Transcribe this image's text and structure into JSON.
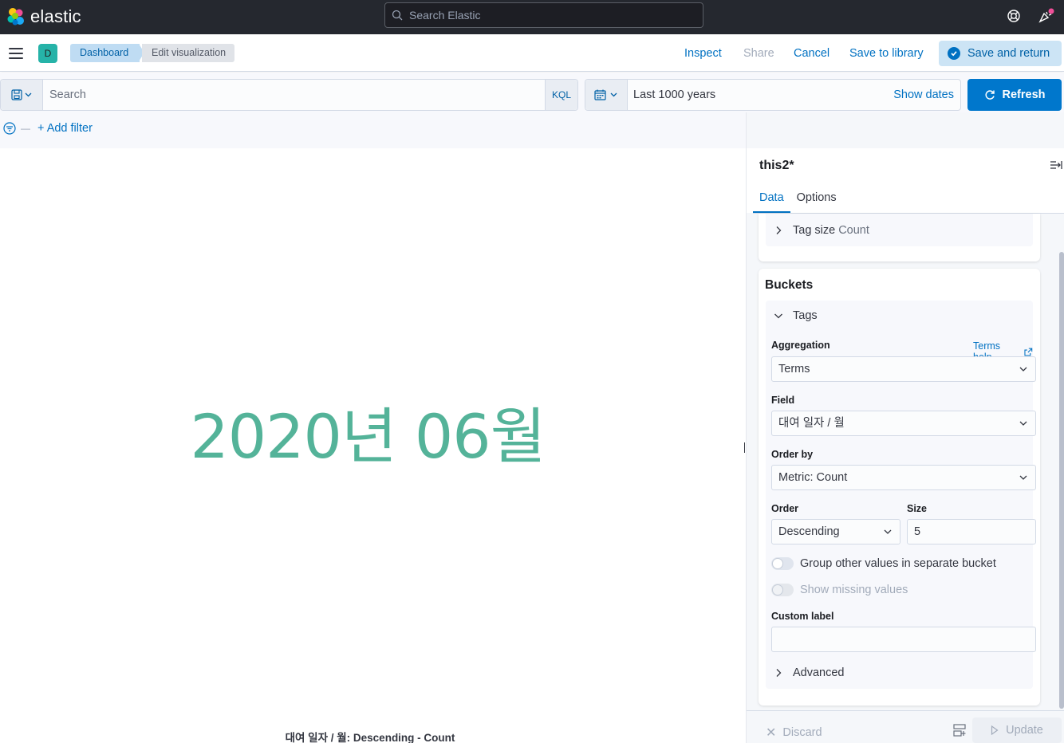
{
  "header": {
    "logo_text": "elastic",
    "search_placeholder": "Search Elastic"
  },
  "navbar": {
    "space_initial": "D",
    "breadcrumbs": [
      "Dashboard",
      "Edit visualization"
    ],
    "links": {
      "inspect": "Inspect",
      "share": "Share",
      "cancel": "Cancel",
      "save_to_library": "Save to library",
      "save_and_return": "Save and return"
    }
  },
  "query_bar": {
    "search_placeholder": "Search",
    "language": "KQL",
    "time_range": "Last 1000 years",
    "show_dates": "Show dates",
    "refresh": "Refresh",
    "add_filter": "+ Add filter"
  },
  "visualization": {
    "tag": "2020년 06월",
    "caption": "대여 일자 / 월: Descending - Count",
    "tag_color": "#54b399"
  },
  "sidebar": {
    "title": "this2*",
    "tabs": [
      "Data",
      "Options"
    ],
    "active_tab": "Data",
    "metric": {
      "label_prefix": "Tag size",
      "label_value": "Count"
    },
    "buckets": {
      "title": "Buckets",
      "group": "Tags",
      "aggregation_label": "Aggregation",
      "aggregation_help": "Terms help",
      "aggregation_value": "Terms",
      "field_label": "Field",
      "field_value": "대여 일자 / 월",
      "order_by_label": "Order by",
      "order_by_value": "Metric: Count",
      "order_label": "Order",
      "order_value": "Descending",
      "size_label": "Size",
      "size_value": "5",
      "group_other": "Group other values in separate bucket",
      "show_missing": "Show missing values",
      "custom_label": "Custom label",
      "custom_label_value": "",
      "advanced": "Advanced"
    },
    "footer": {
      "discard": "Discard",
      "update": "Update"
    }
  },
  "colors": {
    "accent": "#0077cc",
    "header_bg": "#25282f"
  }
}
